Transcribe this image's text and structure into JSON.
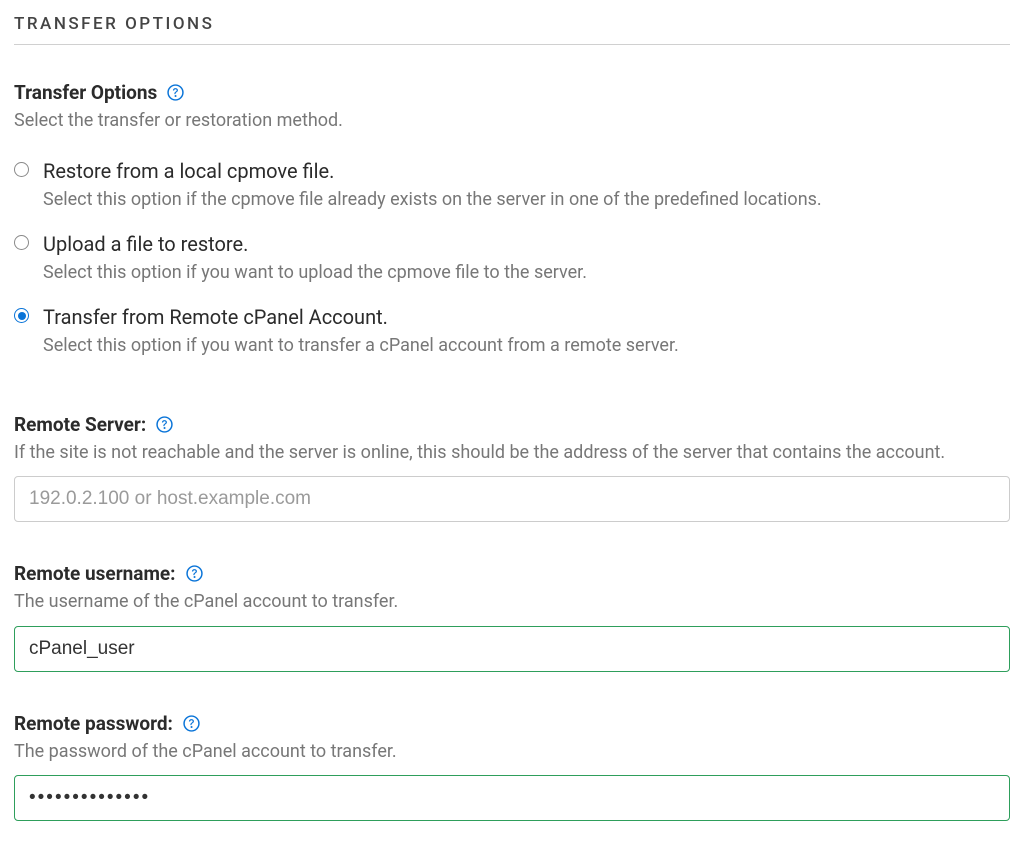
{
  "section_header": "TRANSFER OPTIONS",
  "transfer_options": {
    "title": "Transfer Options",
    "subtitle": "Select the transfer or restoration method.",
    "options": [
      {
        "label": "Restore from a local cpmove file.",
        "desc": "Select this option if the cpmove file already exists on the server in one of the predefined locations.",
        "selected": false
      },
      {
        "label": "Upload a file to restore.",
        "desc": "Select this option if you want to upload the cpmove file to the server.",
        "selected": false
      },
      {
        "label": "Transfer from Remote cPanel Account.",
        "desc": "Select this option if you want to transfer a cPanel account from a remote server.",
        "selected": true
      }
    ]
  },
  "remote_server": {
    "label": "Remote Server:",
    "desc": "If the site is not reachable and the server is online, this should be the address of the server that contains the account.",
    "placeholder": "192.0.2.100 or host.example.com",
    "value": ""
  },
  "remote_username": {
    "label": "Remote username:",
    "desc": "The username of the cPanel account to transfer.",
    "value": "cPanel_user"
  },
  "remote_password": {
    "label": "Remote password:",
    "desc": "The password of the cPanel account to transfer.",
    "value": "••••••••••••••"
  },
  "colors": {
    "accent": "#0a74d8",
    "valid_border": "#2e9e5b"
  }
}
